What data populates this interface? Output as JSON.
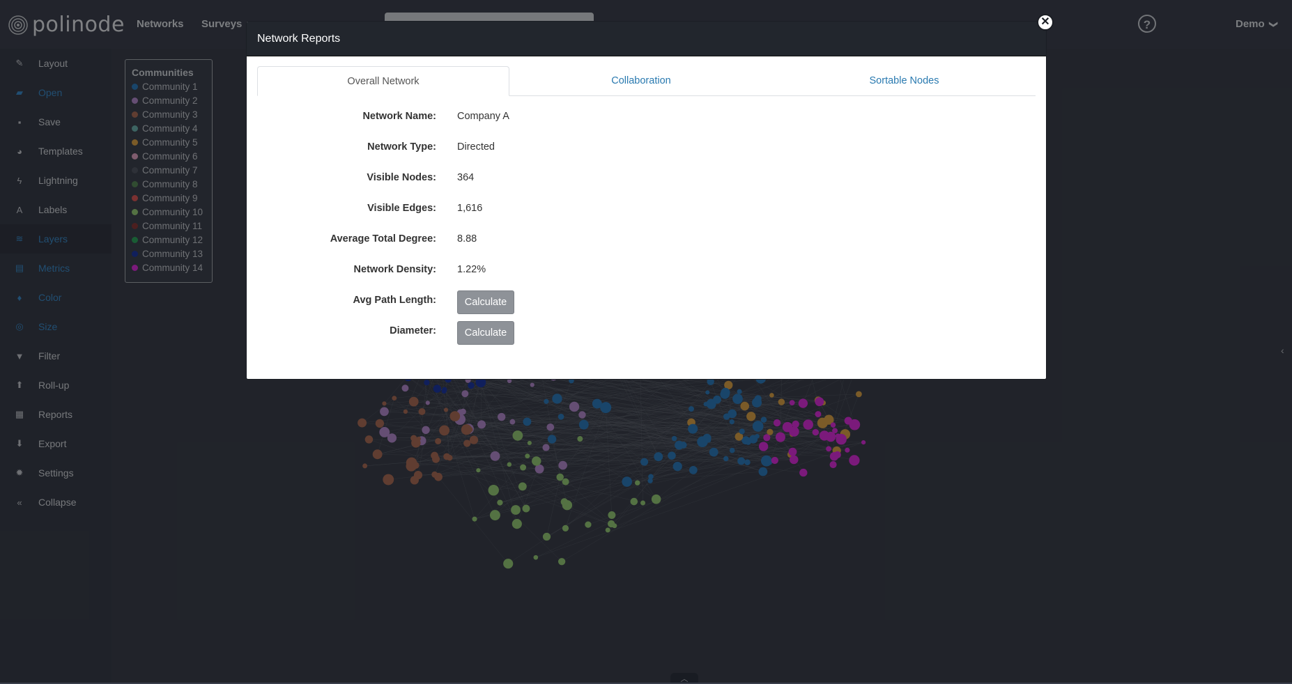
{
  "app": {
    "logo_text": "polinode",
    "nav": [
      "Networks",
      "Surveys"
    ],
    "help_label": "?",
    "user_label": "Demo",
    "user_chevron": "❯"
  },
  "sidebar": {
    "items": [
      {
        "label": "Layout",
        "icon": "wand-icon",
        "glyph": "✎"
      },
      {
        "label": "Open",
        "icon": "folder-icon",
        "glyph": "▰",
        "accent": true
      },
      {
        "label": "Save",
        "icon": "save-icon",
        "glyph": "▪"
      },
      {
        "label": "Templates",
        "icon": "palette-icon",
        "glyph": "◕"
      },
      {
        "label": "Lightning",
        "icon": "bolt-icon",
        "glyph": "ϟ"
      },
      {
        "label": "Labels",
        "icon": "font-icon",
        "glyph": "A"
      },
      {
        "label": "Layers",
        "icon": "layers-icon",
        "glyph": "≋",
        "accent": true,
        "active": true
      },
      {
        "label": "Metrics",
        "icon": "clipboard-icon",
        "glyph": "▤",
        "accent": true
      },
      {
        "label": "Color",
        "icon": "droplet-icon",
        "glyph": "♦",
        "accent": true
      },
      {
        "label": "Size",
        "icon": "target-icon",
        "glyph": "◎",
        "accent": true
      },
      {
        "label": "Filter",
        "icon": "filter-icon",
        "glyph": "▼"
      },
      {
        "label": "Roll-up",
        "icon": "arrow-up-icon",
        "glyph": "⬆"
      },
      {
        "label": "Reports",
        "icon": "table-icon",
        "glyph": "▦"
      },
      {
        "label": "Export",
        "icon": "download-icon",
        "glyph": "⬇"
      },
      {
        "label": "Settings",
        "icon": "gear-icon",
        "glyph": "✹"
      },
      {
        "label": "Collapse",
        "icon": "double-chevron-left-icon",
        "glyph": "«"
      }
    ]
  },
  "communities": {
    "title": "Communities",
    "items": [
      {
        "label": "Community 1",
        "color": "#2f7fc1"
      },
      {
        "label": "Community 2",
        "color": "#b98fd3"
      },
      {
        "label": "Community 3",
        "color": "#b0705a"
      },
      {
        "label": "Community 4",
        "color": "#6fb7b3"
      },
      {
        "label": "Community 5",
        "color": "#e0a64a"
      },
      {
        "label": "Community 6",
        "color": "#e8a8c8"
      },
      {
        "label": "Community 7",
        "color": "#555a66"
      },
      {
        "label": "Community 8",
        "color": "#5a8a5a"
      },
      {
        "label": "Community 9",
        "color": "#e05a5a"
      },
      {
        "label": "Community 10",
        "color": "#9ad07a"
      },
      {
        "label": "Community 11",
        "color": "#8a3a3a"
      },
      {
        "label": "Community 12",
        "color": "#2fa860"
      },
      {
        "label": "Community 13",
        "color": "#1e3aa8"
      },
      {
        "label": "Community 14",
        "color": "#e030e0"
      }
    ]
  },
  "modal": {
    "title": "Network Reports",
    "close_glyph": "✕",
    "tabs": [
      {
        "label": "Overall Network",
        "active": true
      },
      {
        "label": "Collaboration",
        "active": false
      },
      {
        "label": "Sortable Nodes",
        "active": false
      }
    ],
    "rows": [
      {
        "label": "Network Name:",
        "value": "Company A"
      },
      {
        "label": "Network Type:",
        "value": "Directed"
      },
      {
        "label": "Visible Nodes:",
        "value": "364"
      },
      {
        "label": "Visible Edges:",
        "value": "1,616"
      },
      {
        "label": "Average Total Degree:",
        "value": "8.88"
      },
      {
        "label": "Network Density:",
        "value": "1.22%"
      }
    ],
    "calc_rows": [
      {
        "label": "Avg Path Length:",
        "button": "Calculate"
      },
      {
        "label": "Diameter:",
        "button": "Calculate"
      }
    ]
  },
  "ui": {
    "side_collapse_glyph": "‹",
    "bottom_handle_glyph": "︿"
  }
}
